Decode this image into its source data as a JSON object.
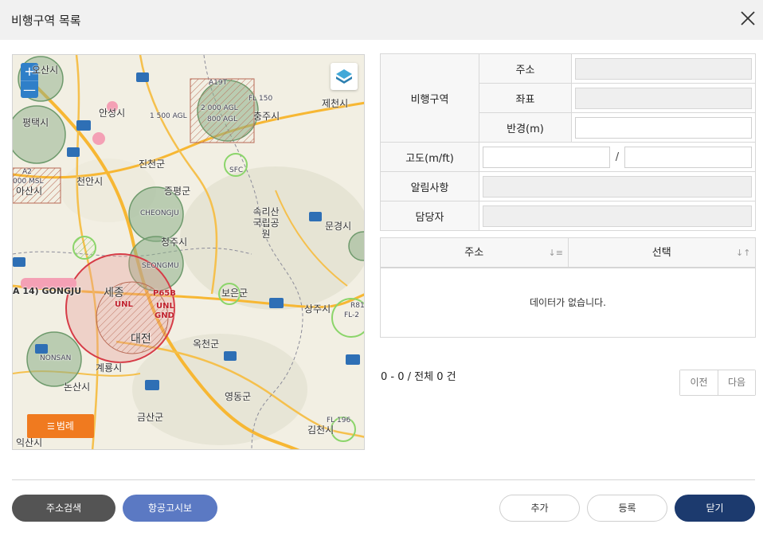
{
  "header": {
    "title": "비행구역 목록"
  },
  "map": {
    "zoom_in": "+",
    "zoom_out": "—",
    "legend_label": "범례",
    "labels": {
      "osan": "오산시",
      "anseong": "안성시",
      "jecheon": "제천시",
      "chungju": "충주시",
      "pyeongtaek": "평택시",
      "cheonan": "천안시",
      "asan": "아산시",
      "jincheon": "진천군",
      "jeungpyeong": "증평군",
      "cheongju": "청주시",
      "songnisan": "속리산 국립공원",
      "mungyeong": "문경시",
      "sejong": "세종",
      "gongju": "A 14) GONGJU",
      "daejeon": "대전",
      "boeun": "보은군",
      "sangju": "상주시",
      "okcheon": "옥천군",
      "gyeryong": "계룡시",
      "nonsan": "논산시",
      "yeongdong": "영동군",
      "geumsan": "금산군",
      "gimcheon": "김천시",
      "iksan": "익산시",
      "a19t": "A19T",
      "fl150": "FL 150",
      "agl1500": "1 500 AGL",
      "agl2000": "2 000 AGL",
      "agl800": "800 AGL",
      "a2": "A2",
      "msl1000": "000 MSL",
      "p65b": "P65B",
      "unl": "UNL",
      "gnd": "GND",
      "fl196": "FL 196",
      "cheongju_ap": "CHEONGJU",
      "seongmu": "SEONGMU",
      "ponsan": "NONSAN",
      "sfc": "SFC",
      "r81": "R81",
      "fl2": "FL-2"
    }
  },
  "form": {
    "group_label": "비행구역",
    "address_label": "주소",
    "coord_label": "좌표",
    "radius_label": "반경(m)",
    "altitude_label": "고도(m/ft)",
    "altitude_sep": "/",
    "notice_label": "알림사항",
    "manager_label": "담당자"
  },
  "grid": {
    "columns": [
      "주소",
      "선택"
    ],
    "empty_text": "데이터가 없습니다."
  },
  "pager": {
    "info": "0 - 0 / 전체 0 건",
    "prev": "이전",
    "next": "다음"
  },
  "buttons": {
    "address_search": "주소검색",
    "notam": "항공고시보",
    "add": "추가",
    "register": "등록",
    "close": "닫기"
  },
  "colors": {
    "header_bg": "#f1f1f1",
    "legend_orange": "#f07a1f",
    "address_btn": "#545454",
    "notam_btn": "#5b79c3",
    "close_btn": "#1c3a6e"
  }
}
